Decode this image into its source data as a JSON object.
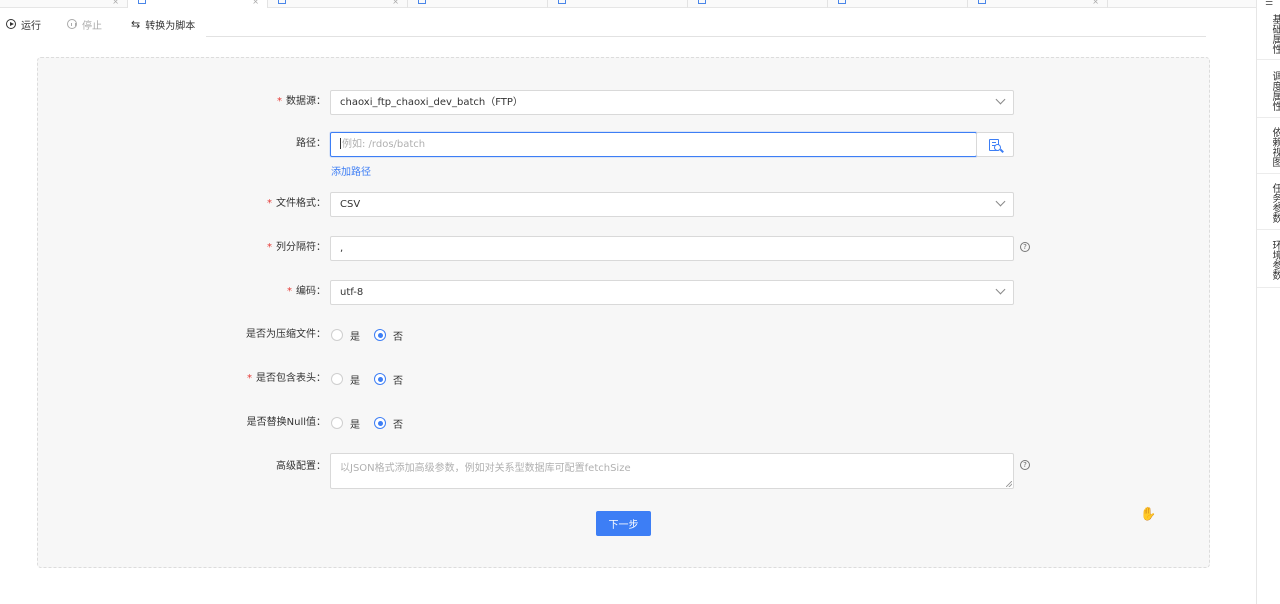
{
  "toolbar": {
    "run_label": "运行",
    "stop_label": "停止",
    "convert_label": "转换为脚本"
  },
  "right_sidebar": {
    "items": [
      {
        "label": "基础属性"
      },
      {
        "label": "调度属性"
      },
      {
        "label": "依赖视图"
      },
      {
        "label": "任务参数"
      },
      {
        "label": "环境参数"
      }
    ]
  },
  "form": {
    "datasource": {
      "label": "数据源",
      "required": "*",
      "value": "chaoxi_ftp_chaoxi_dev_batch（FTP）"
    },
    "path": {
      "label": "路径",
      "placeholder": "例如: /rdos/batch",
      "add_link": "添加路径"
    },
    "file_format": {
      "label": "文件格式",
      "required": "*",
      "value": "CSV"
    },
    "delimiter": {
      "label": "列分隔符",
      "required": "*",
      "value": ","
    },
    "encoding": {
      "label": "编码",
      "required": "*",
      "value": "utf-8"
    },
    "compressed": {
      "label": "是否为压缩文件",
      "yes": "是",
      "no": "否",
      "selected": "否"
    },
    "header": {
      "label": "是否包含表头",
      "required": "*",
      "yes": "是",
      "no": "否",
      "selected": "否"
    },
    "replace_null": {
      "label": "是否替换Null值",
      "yes": "是",
      "no": "否",
      "selected": "否"
    },
    "advanced": {
      "label": "高级配置",
      "placeholder": "以JSON格式添加高级参数，例如对关系型数据库可配置fetchSize"
    },
    "label_colon": "：",
    "next_button": "下一步",
    "help_glyph": "?"
  },
  "colors": {
    "primary": "#3d7ef5",
    "required": "#e53935",
    "panel_bg": "#f7f7f7"
  }
}
